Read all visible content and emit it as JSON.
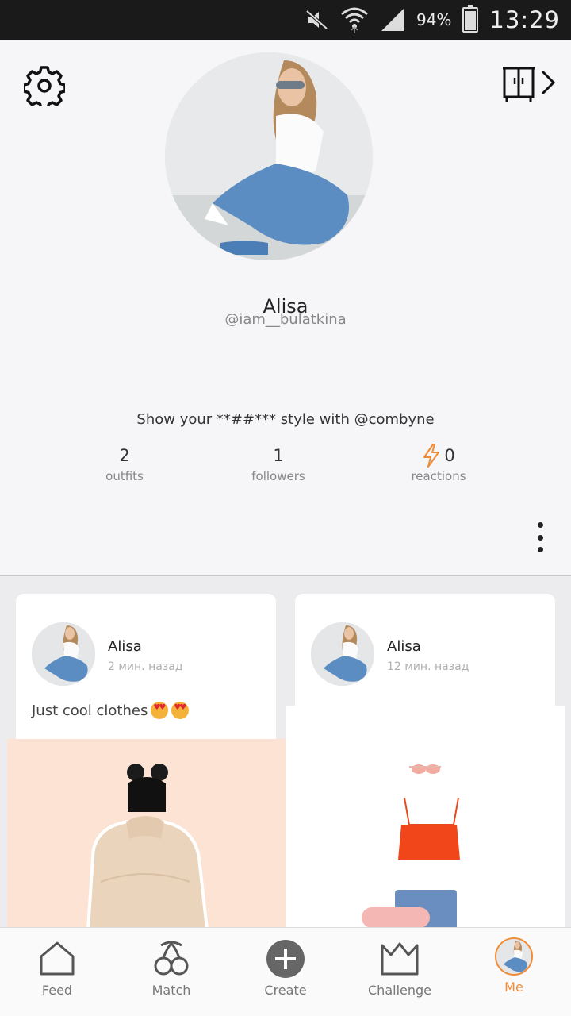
{
  "status_bar": {
    "battery": "94%",
    "time": "13:29",
    "icons": [
      "mute-icon",
      "wifi-icon",
      "signal-icon",
      "battery-icon"
    ]
  },
  "profile": {
    "name": "Alisa",
    "handle": "@iam__bulatkina",
    "bio": "Show your **##*** style with @combyne",
    "stats": [
      {
        "value": "2",
        "label": "outfits"
      },
      {
        "value": "1",
        "label": "followers"
      },
      {
        "value": "0",
        "label": "reactions",
        "icon": "lightning-icon"
      }
    ]
  },
  "feed": {
    "cards": [
      {
        "author": "Alisa",
        "time": "2 мин. назад",
        "caption": "Just cool clothes"
      },
      {
        "author": "Alisa",
        "time": "12 мин. назад",
        "caption": ""
      }
    ]
  },
  "nav": {
    "items": [
      {
        "label": "Feed",
        "icon": "home-icon"
      },
      {
        "label": "Match",
        "icon": "cherry-icon"
      },
      {
        "label": "Create",
        "icon": "plus-circle-icon"
      },
      {
        "label": "Challenge",
        "icon": "crown-icon"
      },
      {
        "label": "Me",
        "icon": "avatar"
      }
    ],
    "active": "Me"
  },
  "colors": {
    "accent": "#f08c37",
    "background": "#f6f6f8",
    "feed_background": "#ececee",
    "status_bar": "#1a1a1a"
  }
}
